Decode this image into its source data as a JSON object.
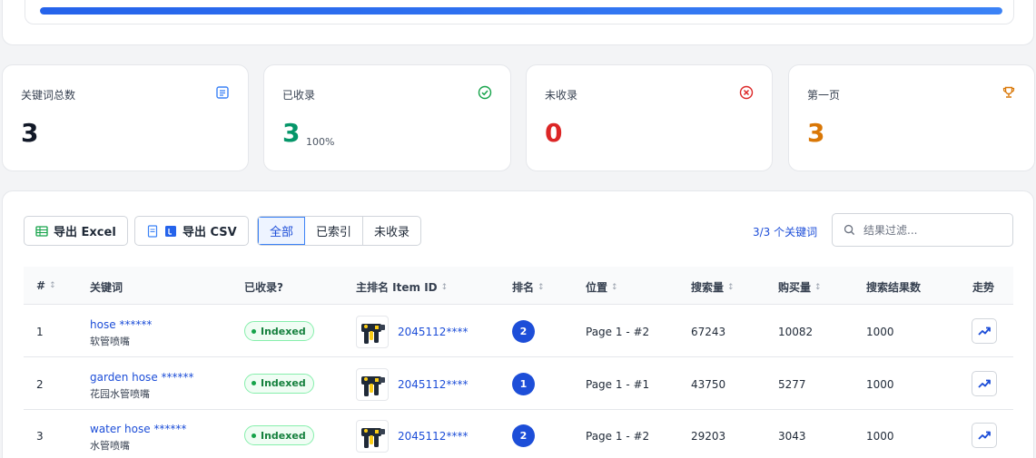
{
  "progress": {
    "percent": 100
  },
  "stats": [
    {
      "label": "关键词总数",
      "value": "3",
      "sub": "",
      "color": "#111827",
      "icon": "list-icon",
      "icon_color": "#3b82f6"
    },
    {
      "label": "已收录",
      "value": "3",
      "sub": "100%",
      "color": "#059669",
      "icon": "check-circle-icon",
      "icon_color": "#16a34a"
    },
    {
      "label": "未收录",
      "value": "0",
      "sub": "",
      "color": "#dc2626",
      "icon": "x-circle-icon",
      "icon_color": "#dc2626"
    },
    {
      "label": "第一页",
      "value": "3",
      "sub": "",
      "color": "#d97706",
      "icon": "trophy-icon",
      "icon_color": "#d97706"
    }
  ],
  "toolbar": {
    "export_excel": "导出 Excel",
    "export_csv": "导出 CSV",
    "filters": [
      "全部",
      "已索引",
      "未收录"
    ],
    "active_filter": 0,
    "count_text": "3/3 个关键词",
    "filter_placeholder": "结果过滤..."
  },
  "table": {
    "headers": {
      "num": "#",
      "keyword": "关键词",
      "indexed": "已收录?",
      "item": "主排名 Item ID",
      "rank": "排名",
      "position": "位置",
      "search_volume": "搜索量",
      "purchase": "购买量",
      "results": "搜索结果数",
      "trend": "走势"
    },
    "rows": [
      {
        "num": "1",
        "keyword": "hose ******",
        "keyword_cn": "软管喷嘴",
        "status": "Indexed",
        "item_id": "2045112****",
        "rank": "2",
        "position": "Page 1 - #2",
        "search_volume": "67243",
        "purchase": "10082",
        "results": "1000"
      },
      {
        "num": "2",
        "keyword": "garden hose ******",
        "keyword_cn": "花园水管喷嘴",
        "status": "Indexed",
        "item_id": "2045112****",
        "rank": "1",
        "position": "Page 1 - #1",
        "search_volume": "43750",
        "purchase": "5277",
        "results": "1000"
      },
      {
        "num": "3",
        "keyword": "water hose ******",
        "keyword_cn": "水管喷嘴",
        "status": "Indexed",
        "item_id": "2045112****",
        "rank": "2",
        "position": "Page 1 - #2",
        "search_volume": "29203",
        "purchase": "3043",
        "results": "1000"
      }
    ]
  }
}
